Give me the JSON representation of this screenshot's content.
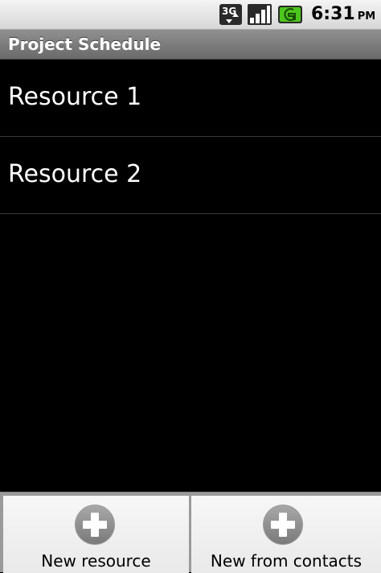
{
  "status_bar": {
    "network_badge": "3G",
    "icons": [
      "network-3g-icon",
      "signal-strength-icon",
      "battery-charging-icon"
    ],
    "time": "6:31",
    "ampm": "PM"
  },
  "title_bar": {
    "title": "Project Schedule"
  },
  "list": {
    "items": [
      {
        "label": "Resource 1"
      },
      {
        "label": "Resource 2"
      }
    ]
  },
  "button_bar": {
    "new_resource_label": "New resource",
    "new_from_contacts_label": "New from contacts",
    "icon": "plus-circle-icon"
  },
  "colors": {
    "background": "#000000",
    "title_bar": "#7a7a7a",
    "battery_accent": "#4cc61d",
    "list_text": "#ffffff",
    "divider": "#3a3a3a"
  }
}
